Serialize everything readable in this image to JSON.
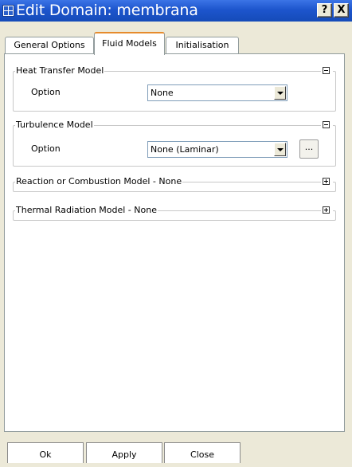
{
  "window": {
    "title": "Edit Domain: membrana",
    "help_button": "?",
    "close_button": "X"
  },
  "tabs": [
    {
      "label": "General Options",
      "active": false
    },
    {
      "label": "Fluid Models",
      "active": true
    },
    {
      "label": "Initialisation",
      "active": false
    }
  ],
  "groups": {
    "heat_transfer": {
      "title": "Heat Transfer Model",
      "expanded": true,
      "option_label": "Option",
      "option_value": "None"
    },
    "turbulence": {
      "title": "Turbulence Model",
      "expanded": true,
      "option_label": "Option",
      "option_value": "None (Laminar)",
      "more_button": "..."
    },
    "reaction": {
      "title": "Reaction or Combustion Model - None",
      "expanded": false
    },
    "thermal_radiation": {
      "title": "Thermal Radiation Model - None",
      "expanded": false
    }
  },
  "buttons": {
    "ok": "Ok",
    "apply": "Apply",
    "close": "Close"
  },
  "colors": {
    "titlebar": "#1d55cd",
    "dialog_background": "#ece9d8",
    "active_tab_accent": "#e68b2c"
  }
}
